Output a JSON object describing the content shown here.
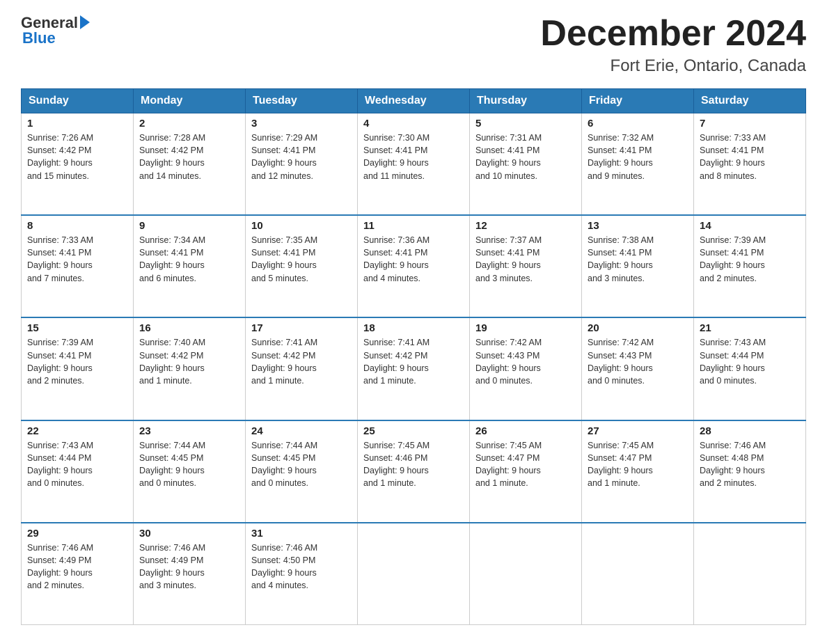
{
  "header": {
    "logo_general": "General",
    "logo_blue": "Blue",
    "title": "December 2024",
    "subtitle": "Fort Erie, Ontario, Canada"
  },
  "days_of_week": [
    "Sunday",
    "Monday",
    "Tuesday",
    "Wednesday",
    "Thursday",
    "Friday",
    "Saturday"
  ],
  "weeks": [
    [
      {
        "day": "1",
        "sunrise": "7:26 AM",
        "sunset": "4:42 PM",
        "daylight": "9 hours and 15 minutes."
      },
      {
        "day": "2",
        "sunrise": "7:28 AM",
        "sunset": "4:42 PM",
        "daylight": "9 hours and 14 minutes."
      },
      {
        "day": "3",
        "sunrise": "7:29 AM",
        "sunset": "4:41 PM",
        "daylight": "9 hours and 12 minutes."
      },
      {
        "day": "4",
        "sunrise": "7:30 AM",
        "sunset": "4:41 PM",
        "daylight": "9 hours and 11 minutes."
      },
      {
        "day": "5",
        "sunrise": "7:31 AM",
        "sunset": "4:41 PM",
        "daylight": "9 hours and 10 minutes."
      },
      {
        "day": "6",
        "sunrise": "7:32 AM",
        "sunset": "4:41 PM",
        "daylight": "9 hours and 9 minutes."
      },
      {
        "day": "7",
        "sunrise": "7:33 AM",
        "sunset": "4:41 PM",
        "daylight": "9 hours and 8 minutes."
      }
    ],
    [
      {
        "day": "8",
        "sunrise": "7:33 AM",
        "sunset": "4:41 PM",
        "daylight": "9 hours and 7 minutes."
      },
      {
        "day": "9",
        "sunrise": "7:34 AM",
        "sunset": "4:41 PM",
        "daylight": "9 hours and 6 minutes."
      },
      {
        "day": "10",
        "sunrise": "7:35 AM",
        "sunset": "4:41 PM",
        "daylight": "9 hours and 5 minutes."
      },
      {
        "day": "11",
        "sunrise": "7:36 AM",
        "sunset": "4:41 PM",
        "daylight": "9 hours and 4 minutes."
      },
      {
        "day": "12",
        "sunrise": "7:37 AM",
        "sunset": "4:41 PM",
        "daylight": "9 hours and 3 minutes."
      },
      {
        "day": "13",
        "sunrise": "7:38 AM",
        "sunset": "4:41 PM",
        "daylight": "9 hours and 3 minutes."
      },
      {
        "day": "14",
        "sunrise": "7:39 AM",
        "sunset": "4:41 PM",
        "daylight": "9 hours and 2 minutes."
      }
    ],
    [
      {
        "day": "15",
        "sunrise": "7:39 AM",
        "sunset": "4:41 PM",
        "daylight": "9 hours and 2 minutes."
      },
      {
        "day": "16",
        "sunrise": "7:40 AM",
        "sunset": "4:42 PM",
        "daylight": "9 hours and 1 minute."
      },
      {
        "day": "17",
        "sunrise": "7:41 AM",
        "sunset": "4:42 PM",
        "daylight": "9 hours and 1 minute."
      },
      {
        "day": "18",
        "sunrise": "7:41 AM",
        "sunset": "4:42 PM",
        "daylight": "9 hours and 1 minute."
      },
      {
        "day": "19",
        "sunrise": "7:42 AM",
        "sunset": "4:43 PM",
        "daylight": "9 hours and 0 minutes."
      },
      {
        "day": "20",
        "sunrise": "7:42 AM",
        "sunset": "4:43 PM",
        "daylight": "9 hours and 0 minutes."
      },
      {
        "day": "21",
        "sunrise": "7:43 AM",
        "sunset": "4:44 PM",
        "daylight": "9 hours and 0 minutes."
      }
    ],
    [
      {
        "day": "22",
        "sunrise": "7:43 AM",
        "sunset": "4:44 PM",
        "daylight": "9 hours and 0 minutes."
      },
      {
        "day": "23",
        "sunrise": "7:44 AM",
        "sunset": "4:45 PM",
        "daylight": "9 hours and 0 minutes."
      },
      {
        "day": "24",
        "sunrise": "7:44 AM",
        "sunset": "4:45 PM",
        "daylight": "9 hours and 0 minutes."
      },
      {
        "day": "25",
        "sunrise": "7:45 AM",
        "sunset": "4:46 PM",
        "daylight": "9 hours and 1 minute."
      },
      {
        "day": "26",
        "sunrise": "7:45 AM",
        "sunset": "4:47 PM",
        "daylight": "9 hours and 1 minute."
      },
      {
        "day": "27",
        "sunrise": "7:45 AM",
        "sunset": "4:47 PM",
        "daylight": "9 hours and 1 minute."
      },
      {
        "day": "28",
        "sunrise": "7:46 AM",
        "sunset": "4:48 PM",
        "daylight": "9 hours and 2 minutes."
      }
    ],
    [
      {
        "day": "29",
        "sunrise": "7:46 AM",
        "sunset": "4:49 PM",
        "daylight": "9 hours and 2 minutes."
      },
      {
        "day": "30",
        "sunrise": "7:46 AM",
        "sunset": "4:49 PM",
        "daylight": "9 hours and 3 minutes."
      },
      {
        "day": "31",
        "sunrise": "7:46 AM",
        "sunset": "4:50 PM",
        "daylight": "9 hours and 4 minutes."
      },
      null,
      null,
      null,
      null
    ]
  ],
  "labels": {
    "sunrise": "Sunrise:",
    "sunset": "Sunset:",
    "daylight": "Daylight:"
  }
}
